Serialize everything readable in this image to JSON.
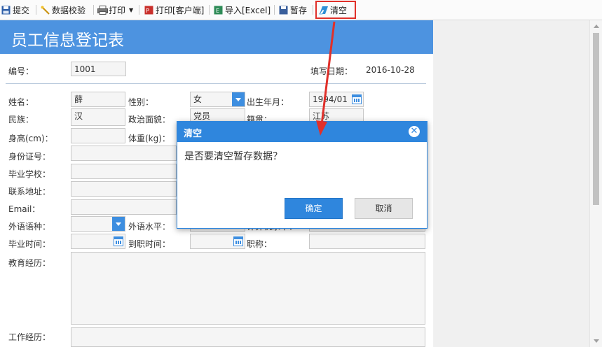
{
  "toolbar": {
    "submit": "提交",
    "validate": "数据校验",
    "print": "打印",
    "print_client": "打印[客户端]",
    "import_excel": "导入[Excel]",
    "save_draft": "暂存",
    "clear": "清空"
  },
  "form": {
    "title": "员工信息登记表",
    "number_label": "编号：",
    "number_value": "1001",
    "fill_date_label": "填写日期：",
    "fill_date_value": "2016-10-28",
    "name_label": "姓名：",
    "name_value": "薛",
    "gender_label": "性别：",
    "gender_value": "女",
    "birth_label": "出生年月：",
    "birth_value": "1994/01",
    "ethnicity_label": "民族：",
    "ethnicity_value": "汉",
    "politics_label": "政治面貌：",
    "politics_value": "党员",
    "native_label": "籍贯：",
    "native_value": "江苏",
    "height_label": "身高(cm)：",
    "weight_label": "体重(kg)：",
    "id_label": "身份证号：",
    "school_label": "毕业学校：",
    "address_label": "联系地址：",
    "email_label": "Email：",
    "language_label": "外语语种：",
    "language_level_label": "外语水平：",
    "computer_level_label": "计算机水平：",
    "graduation_label": "毕业时间：",
    "onboard_label": "到职时间：",
    "title_rank_label": "职称：",
    "education_label": "教育经历：",
    "work_label": "工作经历："
  },
  "dialog": {
    "title": "清空",
    "message": "是否要清空暂存数据？",
    "ok": "确定",
    "cancel": "取消"
  },
  "colors": {
    "header_blue": "#4d93e0",
    "dialog_blue": "#2f86dd",
    "highlight_red": "#e0302a"
  }
}
